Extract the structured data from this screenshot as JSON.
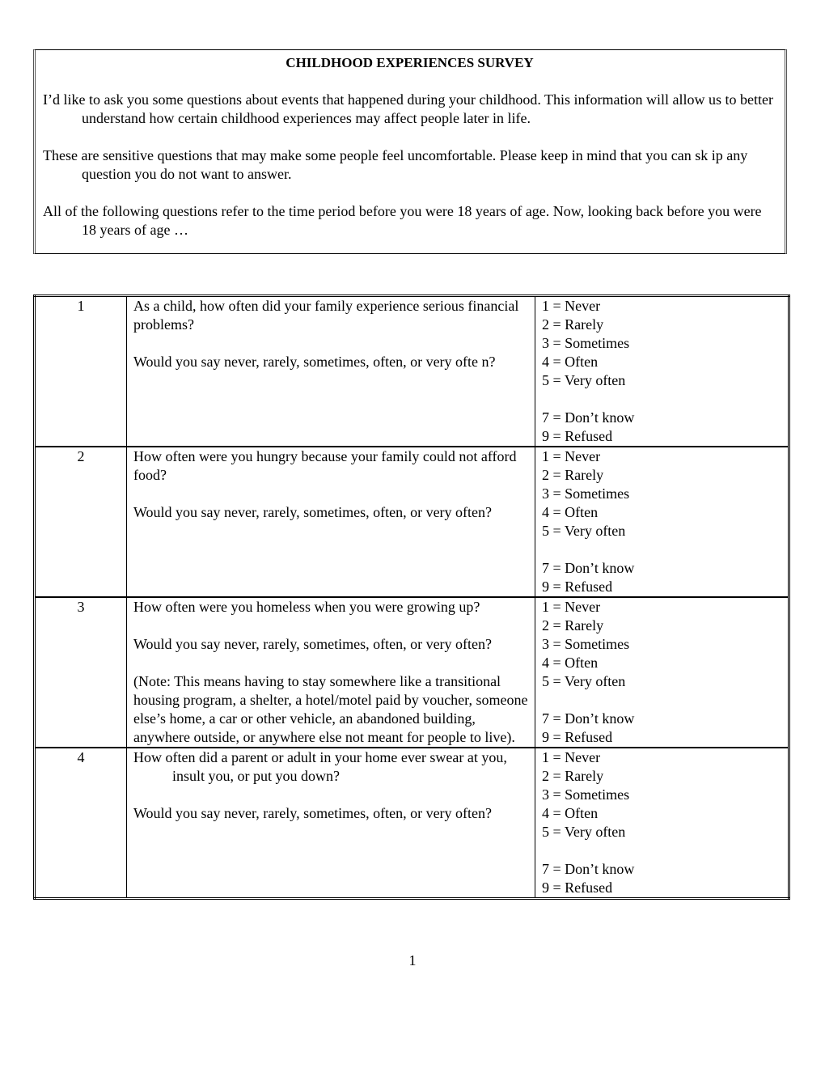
{
  "intro": {
    "title": "CHILDHOOD EXPERIENCES SURVEY",
    "paragraphs": [
      "I’d like to ask you some questions about events that happened during your childhood. This information will allow us to better understand how certain childhood experiences may affect people later in life.",
      "These are sensitive questions that may make some people feel uncomfortable. Please keep in mind that you can sk ip any question you do not want to answer.",
      "All of the following questions refer to the time period before you were 18 years of age. Now, looking back before you were 18 years of age …"
    ]
  },
  "questions": [
    {
      "number": "1",
      "text": "As a child, how often did your family experience serious financial problems?",
      "prompt": "Would you say never, rarely, sometimes, often, or very ofte n?",
      "note": "",
      "answers": [
        "1 = Never",
        "2 = Rarely",
        "3 = Sometimes",
        "4 = Often",
        "5 = Very often",
        "",
        "7 = Don’t know",
        "9 = Refused"
      ]
    },
    {
      "number": "2",
      "text": "How often were you hungry because your family could not afford food?",
      "prompt": "Would you say never, rarely, sometimes, often, or very often?",
      "note": "",
      "answers": [
        "1 = Never",
        "2 = Rarely",
        "3 = Sometimes",
        "4 = Often",
        "5 = Very often",
        "",
        "7 = Don’t know",
        "9 = Refused"
      ]
    },
    {
      "number": "3",
      "text": "How often were you homeless when you were growing up?",
      "prompt": "Would you say never, rarely, sometimes, often, or very often?",
      "note": "(Note:  This means having to stay somewhere like a transitional housing program, a shelter, a hotel/motel paid by voucher, someone else’s home, a car or other vehicle, an abandoned building, anywhere outside, or anywhere else not meant for people to live).",
      "answers": [
        "1 = Never",
        "2 = Rarely",
        "3 = Sometimes",
        "4 = Often",
        "5 = Very often",
        "",
        "7 = Don’t know",
        "9 = Refused"
      ]
    },
    {
      "number": "4",
      "text": "How often did a parent or adult in your home ever swear at you, insult you, or put you down?",
      "prompt": "Would you say never, rarely, sometimes, often, or very often?",
      "note": "",
      "answers": [
        "1 = Never",
        "2 = Rarely",
        "3 = Sometimes",
        "4 = Often",
        "5 = Very often",
        "",
        "7 = Don’t know",
        "9 = Refused"
      ]
    }
  ],
  "footer": {
    "page_number": "1"
  }
}
